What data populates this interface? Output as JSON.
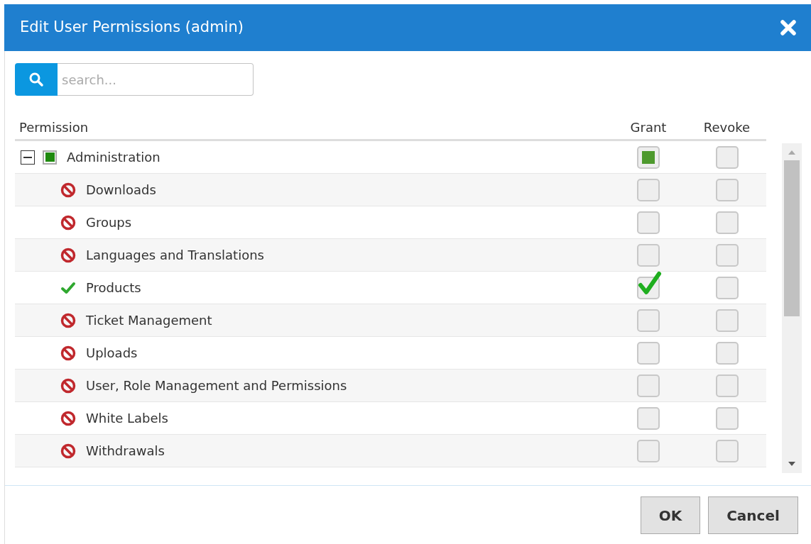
{
  "dialog": {
    "title": "Edit User Permissions (admin)"
  },
  "search": {
    "placeholder": "search..."
  },
  "columns": [
    "Permission",
    "Grant",
    "Revoke"
  ],
  "tree": [
    {
      "label": "Administration",
      "expanded": true,
      "indeterminate": true,
      "grant_checked": false,
      "grant_indeterminate": true,
      "revoke_checked": false,
      "children": [
        {
          "label": "Downloads",
          "allowed": false,
          "grant_checked": false,
          "grant_indeterminate": false,
          "revoke_checked": false
        },
        {
          "label": "Groups",
          "allowed": false,
          "grant_checked": false,
          "grant_indeterminate": false,
          "revoke_checked": false
        },
        {
          "label": "Languages and Translations",
          "allowed": false,
          "grant_checked": false,
          "grant_indeterminate": false,
          "revoke_checked": false
        },
        {
          "label": "Products",
          "allowed": true,
          "grant_checked": true,
          "grant_indeterminate": false,
          "revoke_checked": false
        },
        {
          "label": "Ticket Management",
          "allowed": false,
          "grant_checked": false,
          "grant_indeterminate": false,
          "revoke_checked": false
        },
        {
          "label": "Uploads",
          "allowed": false,
          "grant_checked": false,
          "grant_indeterminate": false,
          "revoke_checked": false
        },
        {
          "label": "User, Role Management and Permissions",
          "allowed": false,
          "grant_checked": false,
          "grant_indeterminate": false,
          "revoke_checked": false
        },
        {
          "label": "White Labels",
          "allowed": false,
          "grant_checked": false,
          "grant_indeterminate": false,
          "revoke_checked": false
        },
        {
          "label": "Withdrawals",
          "allowed": false,
          "grant_checked": false,
          "grant_indeterminate": false,
          "revoke_checked": false
        }
      ]
    }
  ],
  "buttons": [
    "OK",
    "Cancel"
  ]
}
